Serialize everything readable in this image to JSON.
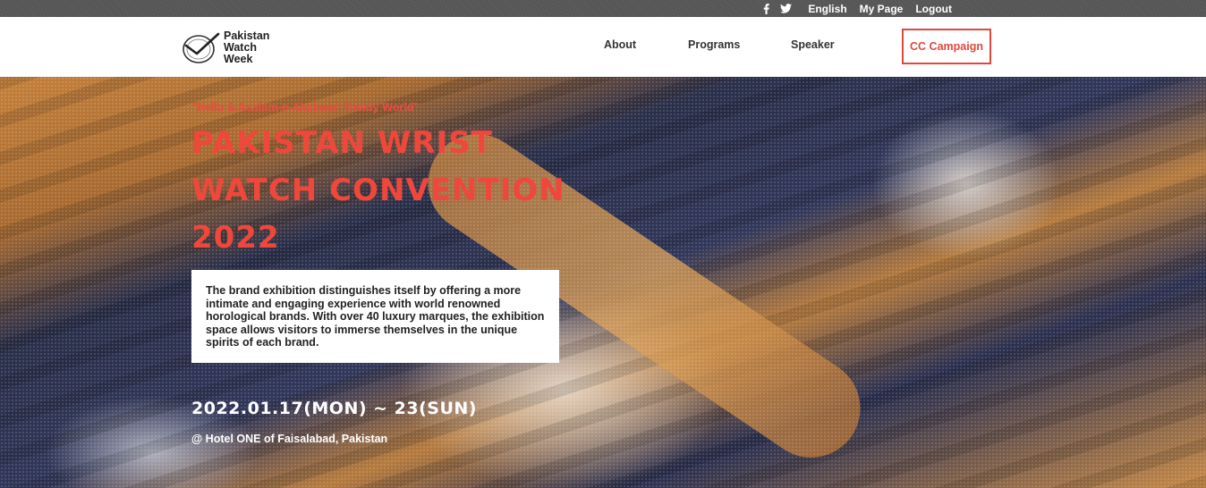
{
  "topbar": {
    "social": [
      "facebook-icon",
      "twitter-icon"
    ],
    "links": [
      "English",
      "My Page",
      "Logout"
    ]
  },
  "header": {
    "logo_lines": [
      "Pakistan",
      "Watch",
      "Week"
    ],
    "nav": [
      "About",
      "Programs",
      "Speaker"
    ],
    "cta": "CC Campaign"
  },
  "hero": {
    "tagline": "\"Hello & Asalam-o-Alaikum! Trendy World\"",
    "title": "PAKISTAN WRIST WATCH CONVENTION 2022",
    "description": "The brand exhibition distinguishes itself by offering a more intimate and engaging experience with world renowned horological brands. With over 40 luxury marques, the exhibition space allows visitors to immerse themselves in the unique spirits of each brand.",
    "date": "2022.01.17(MON) ~ 23(SUN)",
    "venue": "@ Hotel ONE of Faisalabad, Pakistan"
  },
  "colors": {
    "accent": "#e0483d",
    "topbar": "#555555"
  }
}
